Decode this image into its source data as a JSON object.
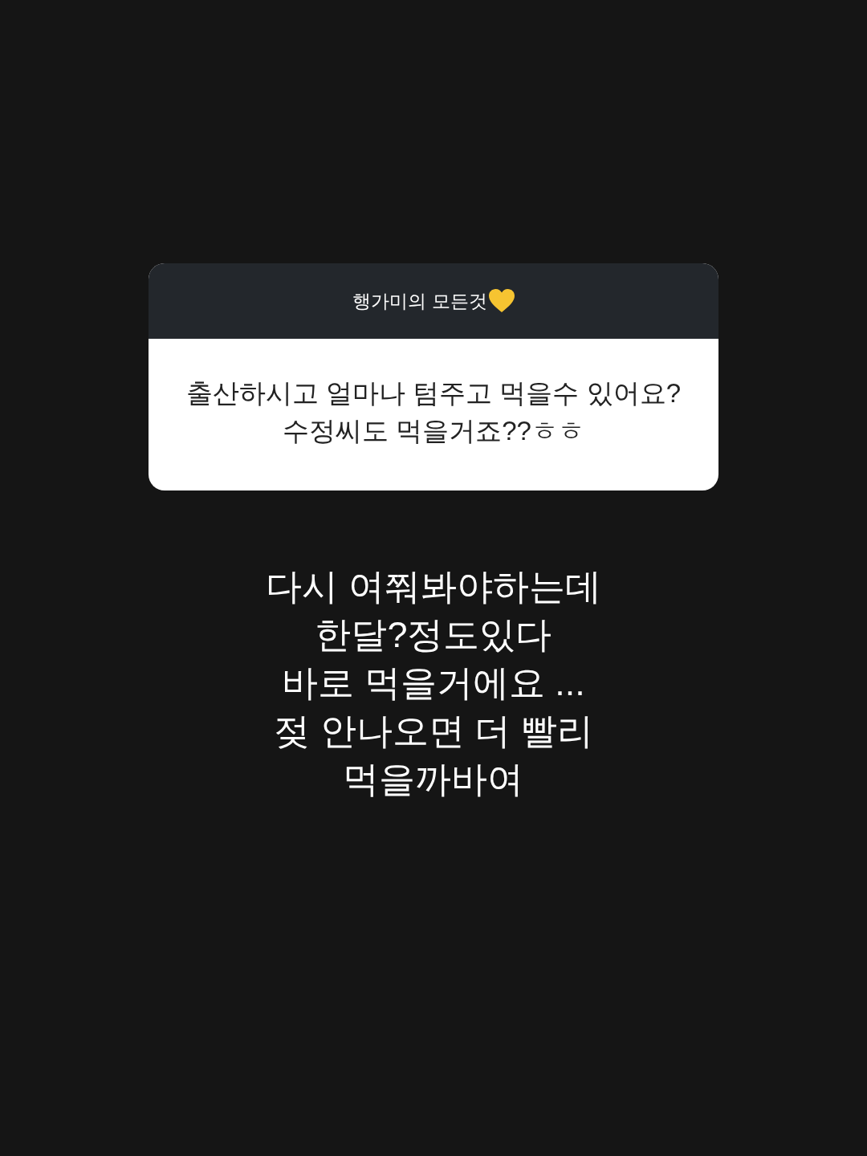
{
  "question_sticker": {
    "header": "행가미의 모든것",
    "question_lines": [
      "출산하시고 얼마나 텀주고 먹을수 있어요?",
      "수정씨도 먹을거죠??ㅎㅎ"
    ]
  },
  "answer_lines": [
    "다시 여쭤봐야하는데",
    "한달?정도있다",
    "바로 먹을거에요 ...",
    "젖 안나오면 더 빨리",
    "먹을까바여"
  ]
}
